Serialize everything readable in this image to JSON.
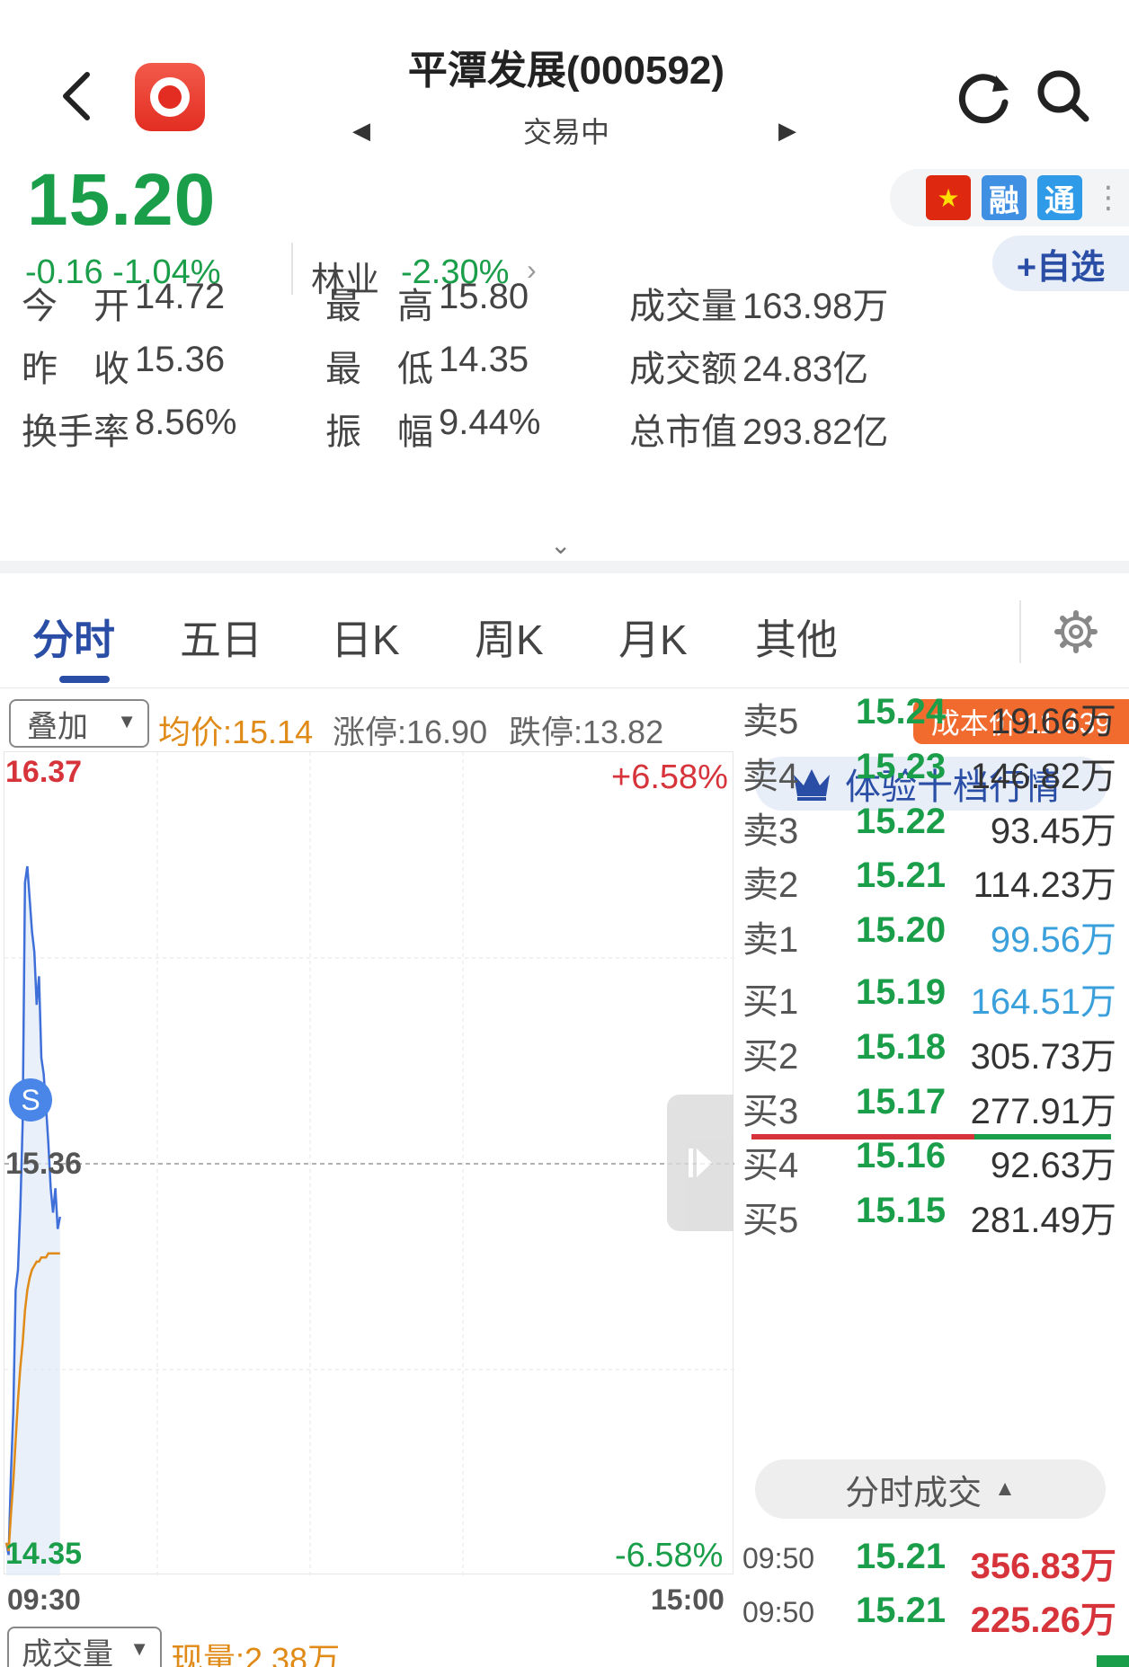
{
  "header": {
    "title": "平潭发展(000592)",
    "status": "交易中",
    "prev_arrow": "◀",
    "next_arrow": "▶"
  },
  "quote": {
    "price": "15.20",
    "change": "-0.16  -1.04%",
    "industry_name": "林业",
    "industry_change": "-2.30%",
    "add_watch": "+自选",
    "badges": {
      "rong": "融",
      "tong": "通"
    }
  },
  "stats": [
    {
      "label": "今　开",
      "value": "14.72"
    },
    {
      "label": "最　高",
      "value": "15.80"
    },
    {
      "label": "成交量",
      "value": "163.98万"
    },
    {
      "label": "昨　收",
      "value": "15.36"
    },
    {
      "label": "最　低",
      "value": "14.35"
    },
    {
      "label": "成交额",
      "value": "24.83亿"
    },
    {
      "label": "换手率",
      "value": "8.56%"
    },
    {
      "label": "振　幅",
      "value": "9.44%"
    },
    {
      "label": "总市值",
      "value": "293.82亿"
    }
  ],
  "tabs": [
    "分时",
    "五日",
    "日K",
    "周K",
    "月K",
    "其他"
  ],
  "overlay": {
    "select_label": "叠加",
    "avg_price": "均价:15.14",
    "limit_up": "涨停:16.90",
    "limit_down": "跌停:13.82",
    "cost_price": "成本价:11.439"
  },
  "chart": {
    "y_high": "16.37",
    "y_low": "14.35",
    "y_mid": "15.36",
    "pct_high": "+6.58%",
    "pct_low": "-6.58%",
    "time_start": "09:30",
    "time_end": "15:00",
    "marker": "S"
  },
  "chart_data": {
    "type": "line",
    "ylim": [
      14.35,
      16.37
    ],
    "series": [
      {
        "values": [
          14.43,
          14.4,
          14.6,
          14.75,
          15.05,
          15.1,
          15.25,
          15.46,
          16.05,
          16.09,
          16.01,
          15.93,
          15.88,
          15.75,
          15.82,
          15.62,
          15.58,
          15.5,
          15.41,
          15.3,
          15.24,
          15.3,
          15.2,
          15.23
        ]
      },
      {
        "values": [
          14.43,
          14.41,
          14.5,
          14.58,
          14.68,
          14.78,
          14.86,
          14.92,
          15.0,
          15.05,
          15.08,
          15.1,
          15.11,
          15.12,
          15.12,
          15.13,
          15.13,
          15.13,
          15.14,
          15.14,
          15.14,
          15.14,
          15.14,
          15.14
        ]
      }
    ],
    "colors": [
      "#3f6fd8",
      "#e08a17"
    ]
  },
  "orderbook": {
    "level10_label": "体验十档行情",
    "sells": [
      {
        "label": "卖5",
        "price": "15.24",
        "volume": "19.66万"
      },
      {
        "label": "卖4",
        "price": "15.23",
        "volume": "146.82万"
      },
      {
        "label": "卖3",
        "price": "15.22",
        "volume": "93.45万"
      },
      {
        "label": "卖2",
        "price": "15.21",
        "volume": "114.23万"
      },
      {
        "label": "卖1",
        "price": "15.20",
        "volume": "99.56万"
      }
    ],
    "buys": [
      {
        "label": "买1",
        "price": "15.19",
        "volume": "164.51万"
      },
      {
        "label": "买2",
        "price": "15.18",
        "volume": "305.73万"
      },
      {
        "label": "买3",
        "price": "15.17",
        "volume": "277.91万"
      },
      {
        "label": "买4",
        "price": "15.16",
        "volume": "92.63万"
      },
      {
        "label": "买5",
        "price": "15.15",
        "volume": "281.49万"
      }
    ],
    "spread_ratio": 0.62
  },
  "trades": {
    "toggle_label": "分时成交",
    "rows": [
      {
        "time": "09:50",
        "price": "15.21",
        "volume": "356.83万"
      },
      {
        "time": "09:50",
        "price": "15.21",
        "volume": "225.26万"
      }
    ]
  },
  "volume": {
    "select_label": "成交量",
    "current": "现量:2.38万"
  },
  "colors": {
    "up": "#d6343a",
    "down": "#1a9e4a",
    "accent": "#2a4ea6",
    "avg": "#e08a17",
    "cost": "#f26b2e"
  }
}
